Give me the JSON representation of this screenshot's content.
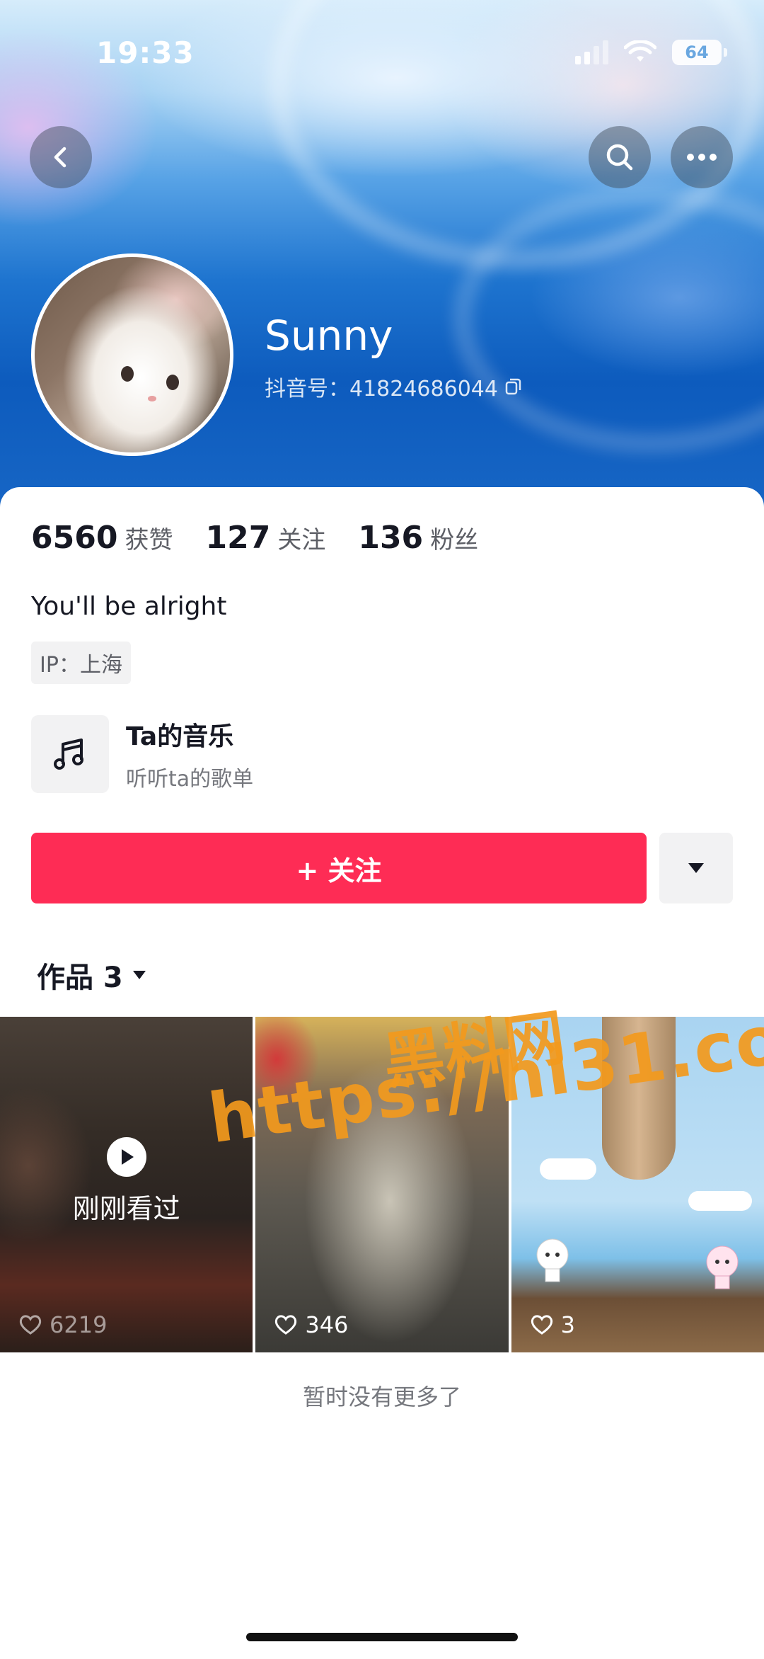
{
  "status_bar": {
    "time": "19:33",
    "battery": "64",
    "icons": [
      "signal-icon",
      "wifi-icon",
      "battery-icon"
    ]
  },
  "nav": {
    "back_icon": "chevron-left-icon",
    "search_icon": "search-icon",
    "more_icon": "more-horizontal-icon"
  },
  "profile": {
    "username": "Sunny",
    "douyin_id": "抖音号：41824686044",
    "copy_icon": "copy-icon",
    "stats": [
      {
        "value": "6560",
        "label": "获赞"
      },
      {
        "value": "127",
        "label": "关注"
      },
      {
        "value": "136",
        "label": "粉丝"
      }
    ],
    "bio": "You'll be alright",
    "ip": "IP：上海"
  },
  "music": {
    "title": "Ta的音乐",
    "subtitle": "听听ta的歌单",
    "icon": "music-note-icon"
  },
  "actions": {
    "follow_label": "+ 关注",
    "dropdown_icon": "caret-down-icon"
  },
  "works": {
    "tab_label": "作品 3",
    "videos": [
      {
        "likes": "6219",
        "overlay": "刚刚看过"
      },
      {
        "likes": "346"
      },
      {
        "likes": "3"
      }
    ]
  },
  "footer": {
    "no_more": "暂时没有更多了"
  },
  "watermark": {
    "line1": "黑料网",
    "line2": "https://hl31.co"
  },
  "colors": {
    "follow": "#fe2c55",
    "banner": "#1e74cf",
    "watermark": "#f39a1d"
  }
}
